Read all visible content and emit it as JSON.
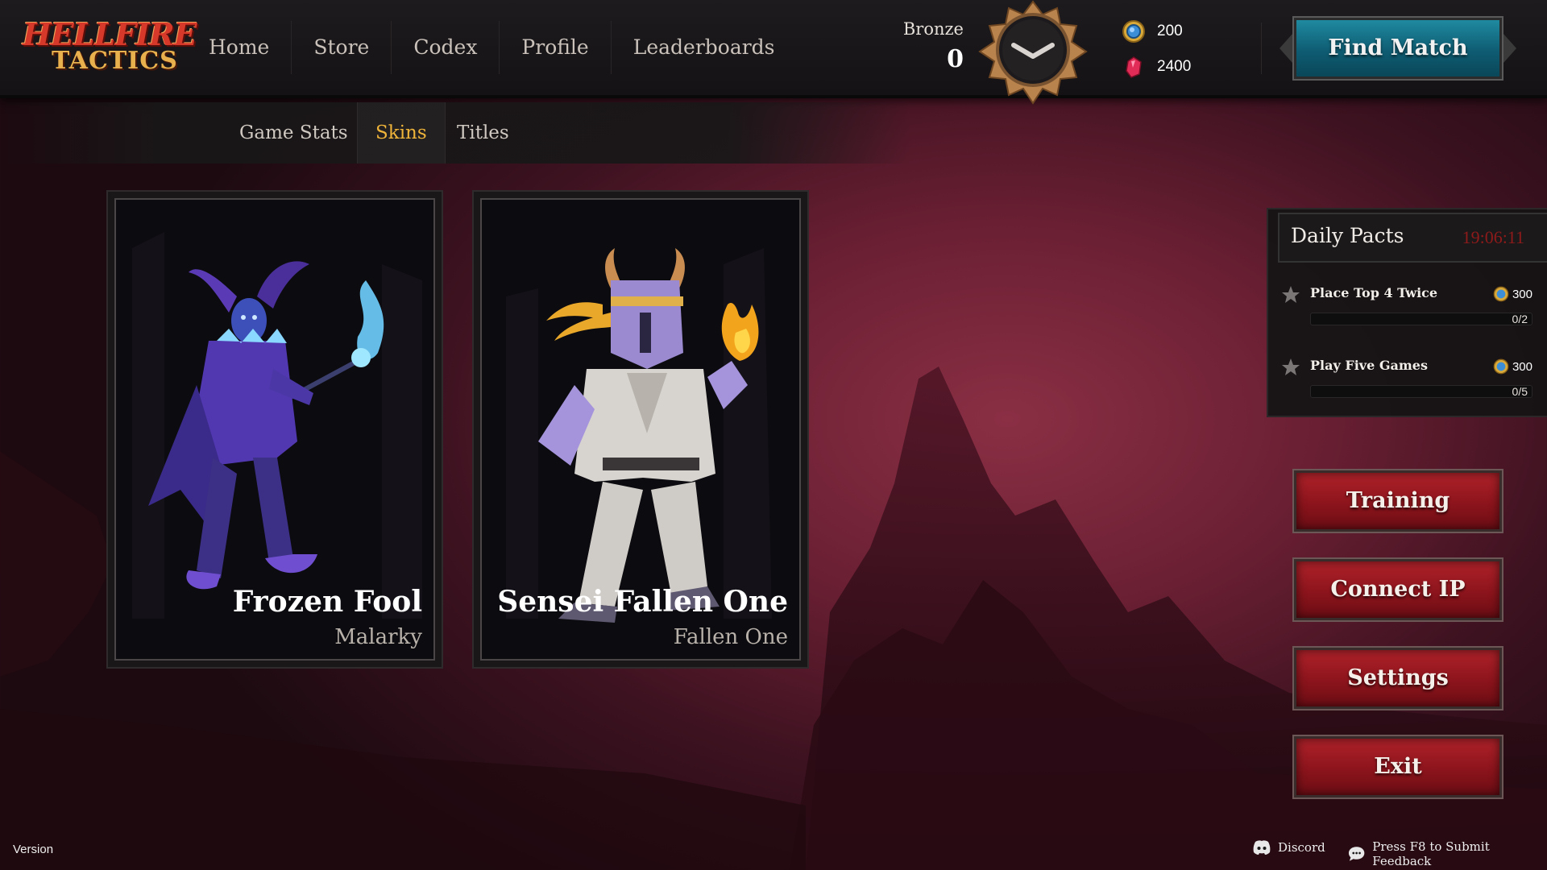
{
  "app": {
    "logo_line1": "HELLFIRE",
    "logo_line2": "TACTICS"
  },
  "nav": {
    "items": [
      {
        "label": "Home"
      },
      {
        "label": "Store"
      },
      {
        "label": "Codex"
      },
      {
        "label": "Profile"
      },
      {
        "label": "Leaderboards"
      }
    ]
  },
  "rank": {
    "label": "Bronze",
    "value": "0"
  },
  "currency": {
    "gold": "200",
    "gems": "2400"
  },
  "find_match": {
    "label": "Find Match"
  },
  "subtabs": [
    {
      "label": "Game Stats",
      "active": false
    },
    {
      "label": "Skins",
      "active": true
    },
    {
      "label": "Titles",
      "active": false
    }
  ],
  "skins": [
    {
      "name": "Frozen Fool",
      "character": "Malarky"
    },
    {
      "name": "Sensei Fallen One",
      "character": "Fallen One"
    }
  ],
  "daily_pacts": {
    "title": "Daily Pacts",
    "timer": "19:06:11",
    "pacts": [
      {
        "name": "Place Top 4 Twice",
        "reward": "300",
        "progress_text": "0/2",
        "progress": 0
      },
      {
        "name": "Play Five Games",
        "reward": "300",
        "progress_text": "0/5",
        "progress": 0
      }
    ]
  },
  "side_buttons": [
    {
      "label": "Training"
    },
    {
      "label": "Connect IP"
    },
    {
      "label": "Settings"
    },
    {
      "label": "Exit"
    }
  ],
  "footer": {
    "version": "Version",
    "discord": "Discord",
    "feedback": "Press F8 to Submit Feedback"
  },
  "colors": {
    "accent_tab": "#efb43a",
    "find_match": "#0e5c72",
    "red_button": "#8c141c",
    "timer": "#8e1a1a",
    "background": "#6a1f33"
  }
}
